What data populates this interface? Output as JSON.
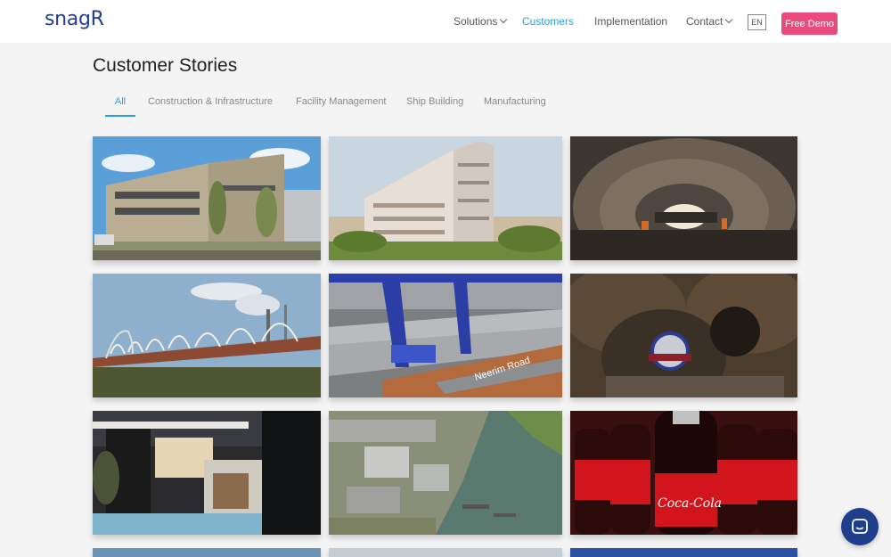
{
  "header": {
    "logo": "snagR",
    "nav": [
      {
        "label": "Solutions",
        "dropdown": true,
        "active": false
      },
      {
        "label": "Customers",
        "dropdown": false,
        "active": true
      },
      {
        "label": "Implementation",
        "dropdown": false,
        "active": false
      },
      {
        "label": "Contact",
        "dropdown": true,
        "active": false
      }
    ],
    "language": "EN",
    "cta": "Free Demo"
  },
  "page": {
    "title": "Customer Stories"
  },
  "tabs": [
    {
      "label": "All",
      "active": true
    },
    {
      "label": "Construction & Infrastructure",
      "active": false
    },
    {
      "label": "Facility Management",
      "active": false
    },
    {
      "label": "Ship Building",
      "active": false
    },
    {
      "label": "Manufacturing",
      "active": false
    }
  ],
  "stories": [
    {
      "image": "timber-clad-building"
    },
    {
      "image": "apartment-tower"
    },
    {
      "image": "road-tunnel-construction"
    },
    {
      "image": "arched-railway-bridge"
    },
    {
      "image": "port-cranes-rendering",
      "overlay_text": "Neerim Road"
    },
    {
      "image": "mine-tunnel-boring-machine"
    },
    {
      "image": "modern-villa-pool"
    },
    {
      "image": "shipyard-aerial"
    },
    {
      "image": "coca-cola-bottles",
      "overlay_text": "Coca-Cola"
    }
  ],
  "colors": {
    "accent": "#2b9fd9",
    "cta": "#e94b7d",
    "brand": "#1f3f8c"
  }
}
